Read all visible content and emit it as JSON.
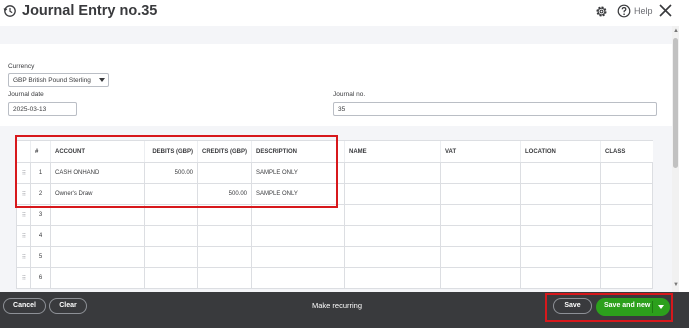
{
  "header": {
    "title": "Journal Entry no.35",
    "help_label": "Help",
    "icons": [
      "history-icon",
      "gear-icon",
      "help-icon",
      "close-icon"
    ]
  },
  "form": {
    "currency_label": "Currency",
    "currency_value": "GBP British Pound Sterling",
    "journal_date_label": "Journal date",
    "journal_date_value": "2025-03-13",
    "journal_no_label": "Journal no.",
    "journal_no_value": "35"
  },
  "table": {
    "columns": {
      "num": "#",
      "account": "ACCOUNT",
      "debits": "DEBITS (GBP)",
      "credits": "CREDITS (GBP)",
      "description": "DESCRIPTION",
      "name": "NAME",
      "vat": "VAT",
      "location": "LOCATION",
      "class": "CLASS"
    },
    "rows": [
      {
        "num": "1",
        "account": "CASH ONHAND",
        "debits": "500.00",
        "credits": "",
        "description": "SAMPLE ONLY"
      },
      {
        "num": "2",
        "account": "Owner's Draw",
        "debits": "",
        "credits": "500.00",
        "description": "SAMPLE ONLY"
      },
      {
        "num": "3",
        "account": "",
        "debits": "",
        "credits": "",
        "description": ""
      },
      {
        "num": "4",
        "account": "",
        "debits": "",
        "credits": "",
        "description": ""
      },
      {
        "num": "5",
        "account": "",
        "debits": "",
        "credits": "",
        "description": ""
      },
      {
        "num": "6",
        "account": "",
        "debits": "",
        "credits": "",
        "description": ""
      }
    ]
  },
  "footer": {
    "cancel_label": "Cancel",
    "clear_label": "Clear",
    "make_recurring_label": "Make recurring",
    "save_label": "Save",
    "save_and_new_label": "Save and new"
  },
  "colors": {
    "primary_green": "#2ca01c",
    "footer_bg": "#393a3d",
    "highlight_red": "#d7181c"
  }
}
